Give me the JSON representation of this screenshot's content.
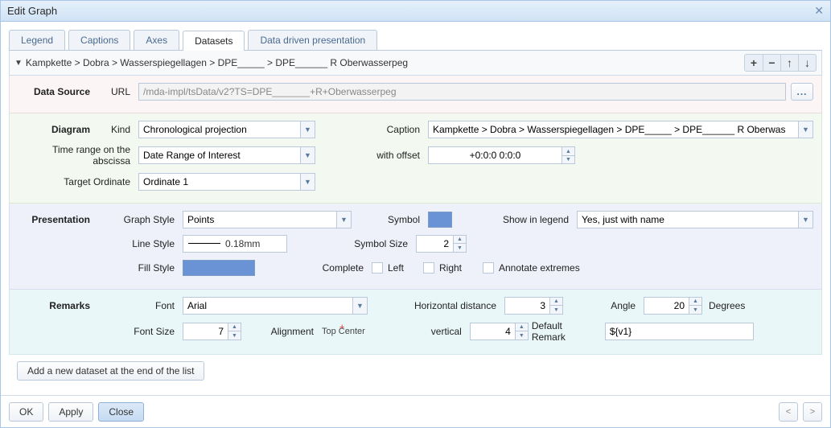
{
  "window": {
    "title": "Edit Graph"
  },
  "tabs": [
    "Legend",
    "Captions",
    "Axes",
    "Datasets",
    "Data driven presentation"
  ],
  "active_tab": 3,
  "breadcrumb": "Kampkette > Dobra > Wasserspiegellagen > DPE_____ > DPE______ R Oberwasserpeg",
  "toolbar": {
    "add": "+",
    "remove": "−",
    "up": "↑",
    "down": "↓"
  },
  "data_source": {
    "section": "Data Source",
    "lab_url": "URL",
    "url": "/mda-impl/tsData/v2?TS=DPE_______+R+Oberwasserpeg",
    "ellipsis": "..."
  },
  "diagram": {
    "section": "Diagram",
    "lab_kind": "Kind",
    "kind": "Chronological projection",
    "lab_caption": "Caption",
    "caption": "Kampkette > Dobra > Wasserspiegellagen > DPE_____ > DPE______ R Oberwas",
    "lab_range": "Time range on the abscissa",
    "range": "Date Range of Interest",
    "lab_offset": "with offset",
    "offset": "+0:0:0 0:0:0",
    "lab_target": "Target Ordinate",
    "target": "Ordinate 1"
  },
  "presentation": {
    "section": "Presentation",
    "lab_style": "Graph Style",
    "style": "Points",
    "lab_symbol": "Symbol",
    "lab_legend": "Show in legend",
    "legend": "Yes, just with name",
    "lab_line": "Line Style",
    "line_width": "0.18mm",
    "lab_symsize": "Symbol Size",
    "symsize": "2",
    "lab_fill": "Fill Style",
    "lab_complete": "Complete",
    "lab_left": "Left",
    "lab_right": "Right",
    "lab_annot": "Annotate extremes"
  },
  "remarks": {
    "section": "Remarks",
    "lab_font": "Font",
    "font": "Arial",
    "lab_hdist": "Horizontal distance",
    "hdist": "3",
    "lab_angle": "Angle",
    "angle": "20",
    "degrees": "Degrees",
    "lab_fsize": "Font Size",
    "fsize": "7",
    "lab_align": "Alignment",
    "align": "Top Center",
    "lab_vert": "vertical",
    "vert": "4",
    "lab_default": "Default Remark",
    "default": "${v1}"
  },
  "add_button": "Add a new dataset at the end of the list",
  "footer": {
    "ok": "OK",
    "apply": "Apply",
    "close": "Close",
    "prev": "<",
    "next": ">"
  }
}
